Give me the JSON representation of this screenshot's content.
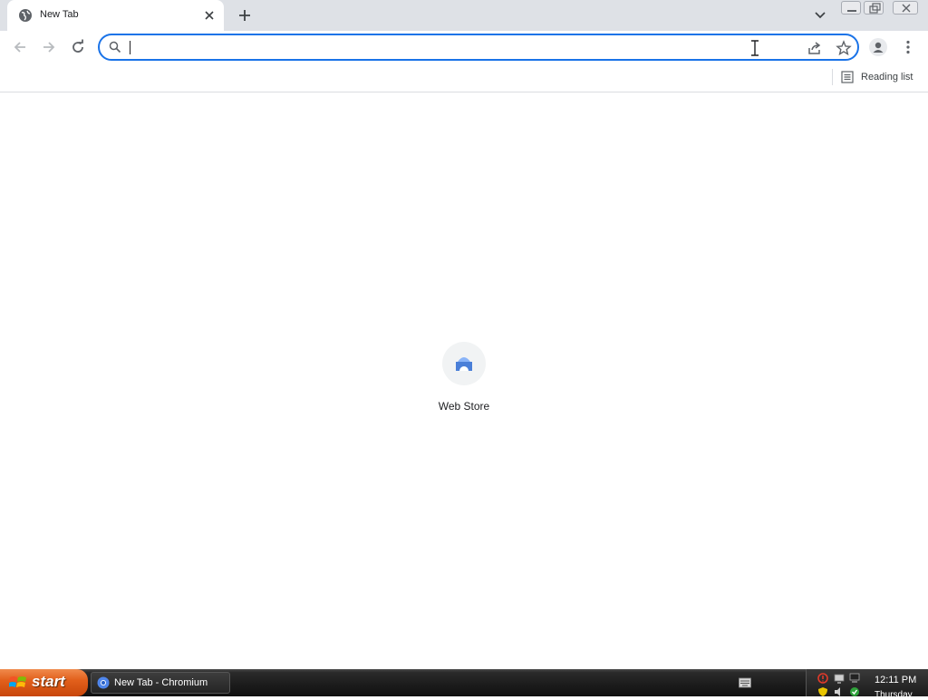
{
  "browser": {
    "tab": {
      "title": "New Tab"
    },
    "omnibox": {
      "value": "",
      "placeholder": ""
    },
    "reading_list_label": "Reading list"
  },
  "newtab": {
    "shortcuts": [
      {
        "label": "Web Store"
      }
    ]
  },
  "taskbar": {
    "start_label": "start",
    "window_button_label": "New Tab - Chromium",
    "clock_time": "12:11 PM",
    "clock_day": "Thursday"
  },
  "colors": {
    "accent": "#1a73e8",
    "tabstrip": "#dee1e6",
    "start": "#e2601c"
  }
}
